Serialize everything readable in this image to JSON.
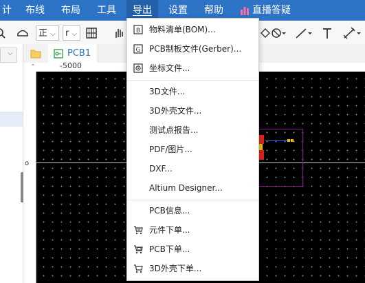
{
  "menubar": {
    "items": [
      "计",
      "布线",
      "布局",
      "工具",
      "导出",
      "设置",
      "帮助"
    ],
    "live_label": "直播答疑",
    "active_index": 4
  },
  "toolbar": {
    "layer_select": "正",
    "r_select": "r",
    "colors": {
      "bar_bg": "#2d73c6",
      "active": "#2460a8"
    }
  },
  "tabs": {
    "pcb_label": "PCB1"
  },
  "ruler": {
    "top_label": "-5000"
  },
  "export_menu": {
    "groups": [
      [
        {
          "label": "物料清单(BOM)...",
          "icon": "bom-icon"
        },
        {
          "label": "PCB制板文件(Gerber)...",
          "icon": "gerber-icon"
        },
        {
          "label": "坐标文件...",
          "icon": "coordinate-file-icon"
        }
      ],
      [
        {
          "label": "3D文件..."
        },
        {
          "label": "3D外壳文件..."
        },
        {
          "label": "测试点报告..."
        },
        {
          "label": "PDF/图片..."
        },
        {
          "label": "DXF..."
        },
        {
          "label": "Altium Designer..."
        }
      ],
      [
        {
          "label": "PCB信息..."
        },
        {
          "label": "元件下单...",
          "icon": "cart-icon"
        },
        {
          "label": "PCB下单...",
          "icon": "cart-pcb-icon"
        },
        {
          "label": "3D外壳下单...",
          "icon": "cart-3d-icon"
        }
      ]
    ]
  }
}
